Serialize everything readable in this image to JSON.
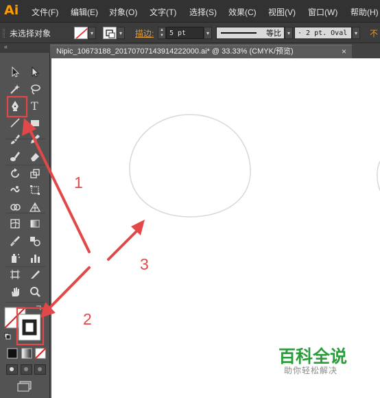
{
  "app": {
    "logo": "Ai"
  },
  "menu": [
    {
      "label": "文件(F)"
    },
    {
      "label": "编辑(E)"
    },
    {
      "label": "对象(O)"
    },
    {
      "label": "文字(T)"
    },
    {
      "label": "选择(S)"
    },
    {
      "label": "效果(C)"
    },
    {
      "label": "视图(V)"
    },
    {
      "label": "窗口(W)"
    },
    {
      "label": "帮助(H)"
    }
  ],
  "control_bar": {
    "selection_status": "未选择对象",
    "stroke_label": "描边:",
    "stroke_weight": "5 pt",
    "stroke_profile_label": "等比",
    "brush": "2 pt. Oval",
    "truncated": "不"
  },
  "document_tab": {
    "title": "Nipic_10673188_20170707143914222000.ai*  @  33.33%  (CMYK/预览)",
    "close": "×"
  },
  "annotations": [
    "1",
    "2",
    "3"
  ],
  "watermark": {
    "title": "百科全说",
    "subtitle": "助你轻松解决"
  },
  "colors": {
    "annotation": "#e34848",
    "logo": "#ff9a00",
    "watermark": "#2a9d3a"
  },
  "tools": [
    "selection-tool",
    "direct-selection-tool",
    "magic-wand-tool",
    "lasso-tool",
    "pen-tool",
    "type-tool",
    "line-segment-tool",
    "rectangle-tool",
    "paintbrush-tool",
    "pencil-tool",
    "blob-brush-tool",
    "eraser-tool",
    "rotate-tool",
    "scale-tool",
    "warp-tool",
    "free-transform-tool",
    "shape-builder-tool",
    "perspective-grid-tool",
    "mesh-tool",
    "gradient-tool",
    "eyedropper-tool",
    "blend-tool",
    "symbol-sprayer-tool",
    "column-graph-tool",
    "artboard-tool",
    "slice-tool",
    "hand-tool",
    "zoom-tool"
  ]
}
